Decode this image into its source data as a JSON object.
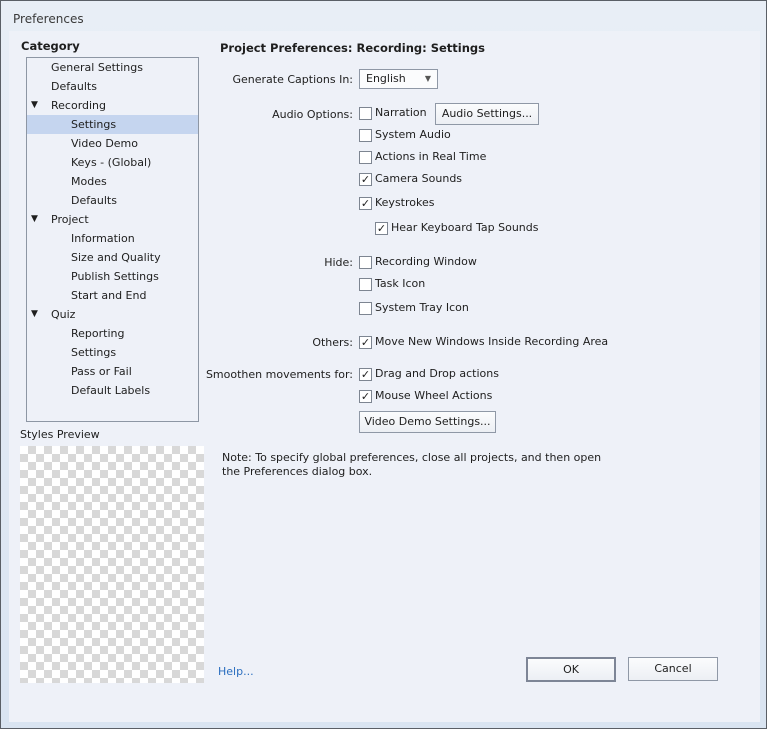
{
  "window": {
    "title": "Preferences"
  },
  "category": {
    "label": "Category",
    "items": [
      {
        "label": "General Settings",
        "level": 0
      },
      {
        "label": "Defaults",
        "level": 0
      },
      {
        "label": "Recording",
        "level": 0,
        "expanded": true
      },
      {
        "label": "Settings",
        "level": 1,
        "selected": true
      },
      {
        "label": "Video Demo",
        "level": 1
      },
      {
        "label": "Keys - (Global)",
        "level": 1
      },
      {
        "label": "Modes",
        "level": 1
      },
      {
        "label": "Defaults",
        "level": 1
      },
      {
        "label": "Project",
        "level": 0,
        "expanded": true
      },
      {
        "label": "Information",
        "level": 1
      },
      {
        "label": "Size and Quality",
        "level": 1
      },
      {
        "label": "Publish Settings",
        "level": 1
      },
      {
        "label": "Start and End",
        "level": 1
      },
      {
        "label": "Quiz",
        "level": 0,
        "expanded": true
      },
      {
        "label": "Reporting",
        "level": 1
      },
      {
        "label": "Settings",
        "level": 1
      },
      {
        "label": "Pass or Fail",
        "level": 1
      },
      {
        "label": "Default Labels",
        "level": 1
      }
    ]
  },
  "styles_preview": "Styles Preview",
  "panel": {
    "heading": "Project Preferences: Recording: Settings",
    "captions_label": "Generate Captions In:",
    "captions_value": "English",
    "audio_label": "Audio Options:",
    "audio_settings_button": "Audio Settings...",
    "hide_label": "Hide:",
    "others_label": "Others:",
    "smoothen_label": "Smoothen movements for:",
    "video_demo_button": "Video Demo Settings...",
    "checkboxes": [
      {
        "label": "Narration",
        "checked": false
      },
      {
        "label": "System Audio",
        "checked": false
      },
      {
        "label": "Actions in Real Time",
        "checked": false
      },
      {
        "label": "Camera Sounds",
        "checked": true
      },
      {
        "label": "Keystrokes",
        "checked": true
      },
      {
        "label": "Hear Keyboard Tap Sounds",
        "checked": true
      },
      {
        "label": "Recording Window",
        "checked": false
      },
      {
        "label": "Task Icon",
        "checked": false
      },
      {
        "label": "System Tray Icon",
        "checked": false
      },
      {
        "label": "Move New Windows Inside Recording Area",
        "checked": true
      },
      {
        "label": "Drag and Drop actions",
        "checked": true
      },
      {
        "label": "Mouse Wheel Actions",
        "checked": true
      }
    ],
    "note_line1": "Note: To specify global preferences, close all projects, and then open",
    "note_line2": "the Preferences dialog box."
  },
  "footer": {
    "help": "Help...",
    "ok": "OK",
    "cancel": "Cancel"
  }
}
